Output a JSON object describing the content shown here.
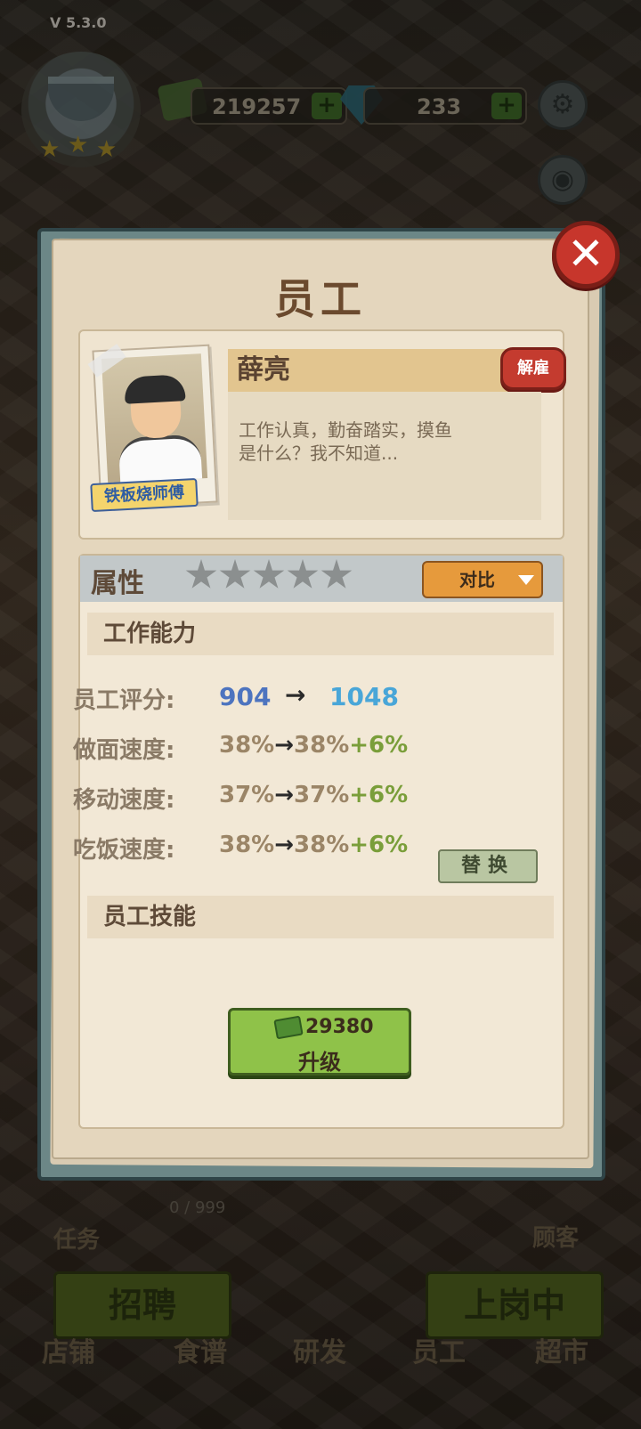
{
  "version": "V 5.3.0",
  "currency": {
    "money": "219257",
    "gems": "233",
    "add_label": "+"
  },
  "modal": {
    "title": "员工",
    "close_label": "✕",
    "employee": {
      "name": "薛亮",
      "job_title": "铁板烧师傅",
      "bio_line1": "工作认真，勤奋踏实，摸鱼",
      "bio_line2": "是什么？我不知道...",
      "fire_label": "解雇"
    },
    "attributes": {
      "title": "属性",
      "star_rating": 0,
      "star_count": 5,
      "compare_label": "对比",
      "work_ability_label": "工作能力",
      "score_label": "员工评分:",
      "score_before": "904",
      "score_arrow": "→",
      "score_after": "1048",
      "stats": [
        {
          "label": "做面速度:",
          "before": "38%",
          "arrow": "→",
          "after": "38%",
          "bonus": "+6%"
        },
        {
          "label": "移动速度:",
          "before": "37%",
          "arrow": "→",
          "after": "37%",
          "bonus": "+6%"
        },
        {
          "label": "吃饭速度:",
          "before": "38%",
          "arrow": "→",
          "after": "38%",
          "bonus": "+6%"
        }
      ],
      "replace_label": "替换",
      "skills_label": "员工技能",
      "upgrade_cost": "29380",
      "upgrade_label": "升级"
    }
  },
  "background": {
    "task_label": "任务",
    "guest_label": "顾客",
    "progress": "0 / 999",
    "recruit_label": "招聘",
    "on_duty_label": "上岗中",
    "tabs": [
      "店铺",
      "食谱",
      "研发",
      "员工",
      "超市"
    ]
  },
  "colors": {
    "close_red": "#c7362c",
    "upgrade_green": "#8fc249",
    "compare_orange": "#e69a3c",
    "score_before_blue": "#4d74bf",
    "score_after_blue": "#49a6d8",
    "bonus_green": "#7a9e3a"
  }
}
